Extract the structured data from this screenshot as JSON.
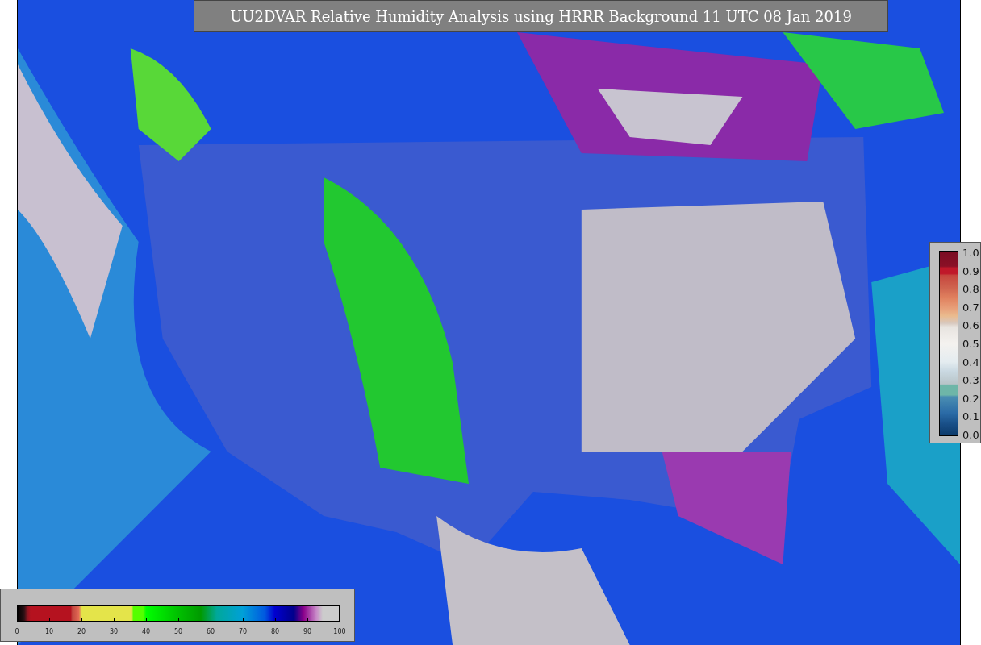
{
  "title": "UU2DVAR Relative Humidity Analysis using HRRR Background 11 UTC 08 Jan 2019",
  "horizontal_colorbar": {
    "ticks": [
      "0",
      "10",
      "20",
      "30",
      "40",
      "50",
      "60",
      "70",
      "80",
      "90",
      "100"
    ]
  },
  "vertical_colorbar": {
    "ticks": [
      "1.0",
      "0.9",
      "0.8",
      "0.7",
      "0.6",
      "0.5",
      "0.4",
      "0.3",
      "0.2",
      "0.1",
      "0.0"
    ]
  }
}
